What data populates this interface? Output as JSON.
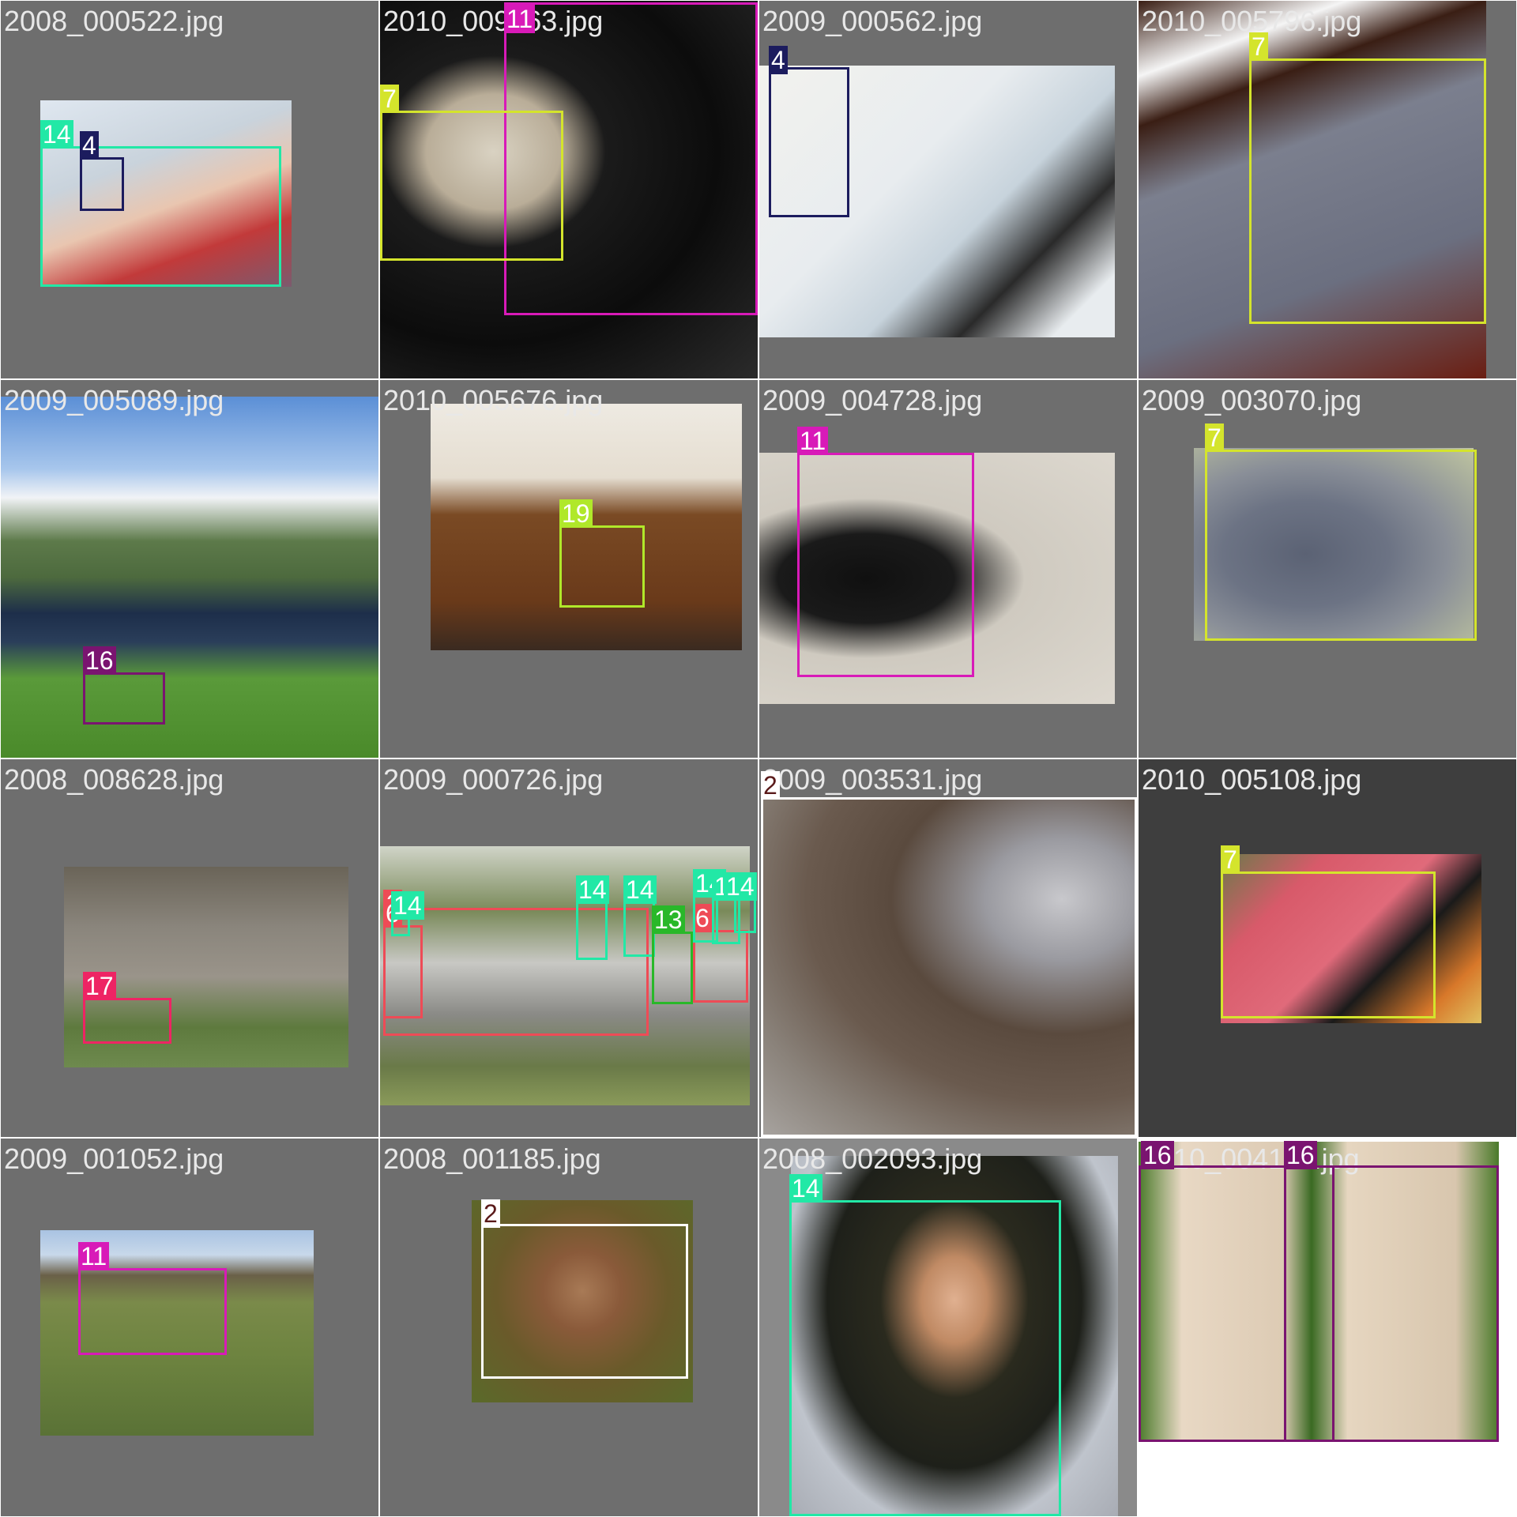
{
  "grid": {
    "columns": 4,
    "rows": 4
  },
  "class_colors": {
    "2": "#ffffff",
    "4": "#1c1c5e",
    "6": "#ee4b56",
    "7": "#d4e42c",
    "11": "#d81ab8",
    "13": "#29b829",
    "14": "#22e8a6",
    "16": "#7a1470",
    "17": "#ee2464",
    "19": "#b0e82a"
  },
  "tiles": [
    {
      "name": "2008_000522.jpg",
      "boxes": [
        {
          "label": "14"
        },
        {
          "label": "4"
        }
      ]
    },
    {
      "name": "2010_009763.jpg",
      "boxes": [
        {
          "label": "11"
        },
        {
          "label": "7"
        }
      ]
    },
    {
      "name": "2009_000562.jpg",
      "boxes": [
        {
          "label": "4"
        }
      ]
    },
    {
      "name": "2010_005796.jpg",
      "boxes": [
        {
          "label": "7"
        }
      ]
    },
    {
      "name": "2009_005089.jpg",
      "boxes": [
        {
          "label": "16"
        }
      ]
    },
    {
      "name": "2010_005676.jpg",
      "boxes": [
        {
          "label": "19"
        }
      ]
    },
    {
      "name": "2009_004728.jpg",
      "boxes": [
        {
          "label": "11"
        }
      ]
    },
    {
      "name": "2009_003070.jpg",
      "boxes": [
        {
          "label": "7"
        }
      ]
    },
    {
      "name": "2008_008628.jpg",
      "boxes": [
        {
          "label": "17"
        }
      ]
    },
    {
      "name": "2009_000726.jpg",
      "boxes": [
        {
          "label": "6"
        },
        {
          "label": "6"
        },
        {
          "label": "14"
        },
        {
          "label": "14"
        },
        {
          "label": "14"
        },
        {
          "label": "13"
        },
        {
          "label": "6"
        },
        {
          "label": "14"
        },
        {
          "label": "14"
        },
        {
          "label": "14"
        }
      ]
    },
    {
      "name": "2009_003531.jpg",
      "boxes": [
        {
          "label": "2"
        }
      ]
    },
    {
      "name": "2010_005108.jpg",
      "boxes": [
        {
          "label": "7"
        }
      ]
    },
    {
      "name": "2009_001052.jpg",
      "boxes": [
        {
          "label": "11"
        }
      ]
    },
    {
      "name": "2008_001185.jpg",
      "boxes": [
        {
          "label": "2"
        }
      ]
    },
    {
      "name": "2008_002093.jpg",
      "boxes": [
        {
          "label": "14"
        }
      ]
    },
    {
      "name": "2010_004118.jpg",
      "boxes": [
        {
          "label": "16"
        },
        {
          "label": "16"
        }
      ]
    }
  ]
}
